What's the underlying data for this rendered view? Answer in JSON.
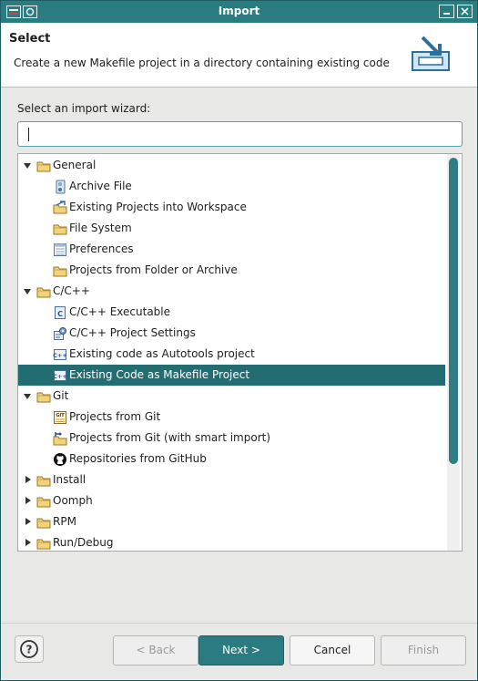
{
  "window": {
    "title": "Import"
  },
  "header": {
    "title": "Select",
    "description": "Create a new Makefile project in a directory containing existing code"
  },
  "filter": {
    "label": "Select an import wizard:",
    "value": ""
  },
  "tree": [
    {
      "label": "General",
      "level": 0,
      "expanded": true,
      "icon": "folder-icon"
    },
    {
      "label": "Archive File",
      "level": 1,
      "icon": "archive-file-icon"
    },
    {
      "label": "Existing Projects into Workspace",
      "level": 1,
      "icon": "import-projects-icon"
    },
    {
      "label": "File System",
      "level": 1,
      "icon": "folder-icon"
    },
    {
      "label": "Preferences",
      "level": 1,
      "icon": "preferences-icon"
    },
    {
      "label": "Projects from Folder or Archive",
      "level": 1,
      "icon": "folder-icon"
    },
    {
      "label": "C/C++",
      "level": 0,
      "expanded": true,
      "icon": "folder-icon"
    },
    {
      "label": "C/C++ Executable",
      "level": 1,
      "icon": "c-file-icon"
    },
    {
      "label": "C/C++ Project Settings",
      "level": 1,
      "icon": "project-settings-icon"
    },
    {
      "label": "Existing code as Autotools project",
      "level": 1,
      "icon": "cpp-code-icon"
    },
    {
      "label": "Existing Code as Makefile Project",
      "level": 1,
      "icon": "cpp-code-icon",
      "selected": true
    },
    {
      "label": "Git",
      "level": 0,
      "expanded": true,
      "icon": "folder-icon"
    },
    {
      "label": "Projects from Git",
      "level": 1,
      "icon": "git-icon"
    },
    {
      "label": "Projects from Git (with smart import)",
      "level": 1,
      "icon": "git-smart-import-icon"
    },
    {
      "label": "Repositories from GitHub",
      "level": 1,
      "icon": "github-icon"
    },
    {
      "label": "Install",
      "level": 0,
      "expanded": false,
      "icon": "folder-icon"
    },
    {
      "label": "Oomph",
      "level": 0,
      "expanded": false,
      "icon": "folder-icon"
    },
    {
      "label": "RPM",
      "level": 0,
      "expanded": false,
      "icon": "folder-icon"
    },
    {
      "label": "Run/Debug",
      "level": 0,
      "expanded": false,
      "icon": "folder-icon"
    }
  ],
  "buttons": {
    "help": "?",
    "back": "< Back",
    "next": "Next >",
    "cancel": "Cancel",
    "finish": "Finish"
  },
  "colors": {
    "accent": "#2b7c81",
    "selection": "#226d72"
  }
}
